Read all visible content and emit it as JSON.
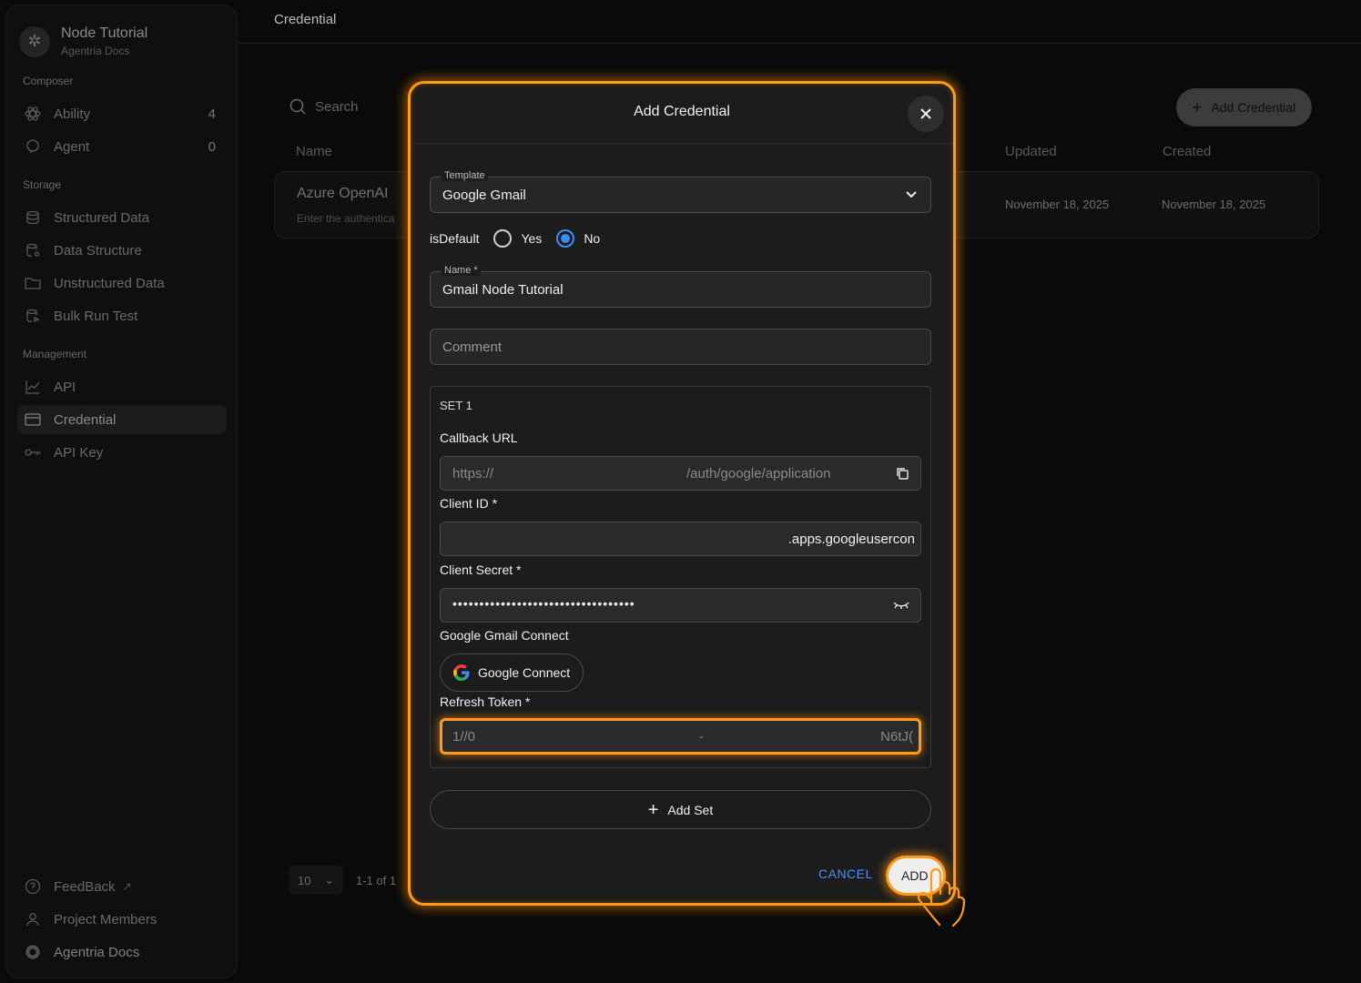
{
  "sidebar": {
    "project_title": "Node Tutorial",
    "project_sub": "Agentria Docs",
    "sections": {
      "composer": "Composer",
      "storage": "Storage",
      "management": "Management"
    },
    "items": [
      {
        "label": "Ability",
        "count": "4",
        "icon": "atom-icon"
      },
      {
        "label": "Agent",
        "count": "0",
        "icon": "agent-icon"
      },
      {
        "label": "Structured Data",
        "icon": "database-icon"
      },
      {
        "label": "Data Structure",
        "icon": "database-settings-icon"
      },
      {
        "label": "Unstructured Data",
        "icon": "folder-icon"
      },
      {
        "label": "Bulk Run Test",
        "icon": "database-run-icon"
      },
      {
        "label": "API",
        "icon": "chart-icon"
      },
      {
        "label": "Credential",
        "icon": "card-icon"
      },
      {
        "label": "API Key",
        "icon": "key-icon"
      }
    ],
    "bottom": [
      {
        "label": "FeedBack",
        "icon": "help-icon"
      },
      {
        "label": "Project Members",
        "icon": "user-icon"
      },
      {
        "label": "Agentria Docs",
        "icon": "gear-icon"
      }
    ]
  },
  "header": {
    "breadcrumb": "Credential"
  },
  "toolbar": {
    "search_placeholder": "Search",
    "add_button": "Add Credential"
  },
  "table": {
    "columns": {
      "name": "Name",
      "updated": "Updated",
      "created": "Created"
    },
    "rows": [
      {
        "name": "Azure OpenAI",
        "desc": "Enter the authentica",
        "updated": "November 18, 2025",
        "created": "November 18, 2025"
      }
    ]
  },
  "pagination": {
    "page_size": "10",
    "range": "1-1 of 1"
  },
  "modal": {
    "title": "Add Credential",
    "template_label": "Template",
    "template_value": "Google Gmail",
    "is_default_label": "isDefault",
    "yes_label": "Yes",
    "no_label": "No",
    "is_default_selected": "No",
    "name_label": "Name *",
    "name_value": "Gmail Node Tutorial",
    "comment_placeholder": "Comment",
    "set": {
      "title": "SET 1",
      "callback_label": "Callback URL",
      "callback_start": "https://",
      "callback_end": "/auth/google/application",
      "client_id_label": "Client ID *",
      "client_id_value": ".apps.googleusercon",
      "client_secret_label": "Client Secret *",
      "client_secret_value": "••••••••••••••••••••••••••••••••••",
      "connect_label": "Google Gmail Connect",
      "connect_button": "Google Connect",
      "refresh_label": "Refresh Token *",
      "refresh_start": "1//0",
      "refresh_mid": "-",
      "refresh_end": "N6tJ("
    },
    "add_set": "Add Set",
    "cancel": "CANCEL",
    "add": "ADD"
  },
  "colors": {
    "accent_orange": "#ff9a1a",
    "link_blue": "#4a8fff",
    "radio_blue": "#3d8bff"
  }
}
